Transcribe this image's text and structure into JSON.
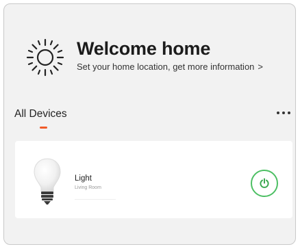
{
  "header": {
    "title": "Welcome home",
    "subtitle": "Set your home location, get more information",
    "chevron": ">"
  },
  "devices_section": {
    "title": "All Devices",
    "more_icon": "more-horizontal-icon"
  },
  "devices": [
    {
      "name": "Light",
      "room": "Living Room",
      "icon": "light-bulb-icon",
      "power_icon": "power-icon"
    }
  ],
  "colors": {
    "accent": "#f05a28",
    "power_on": "#4cbf63",
    "background": "#f2f2f2",
    "card": "#ffffff"
  }
}
